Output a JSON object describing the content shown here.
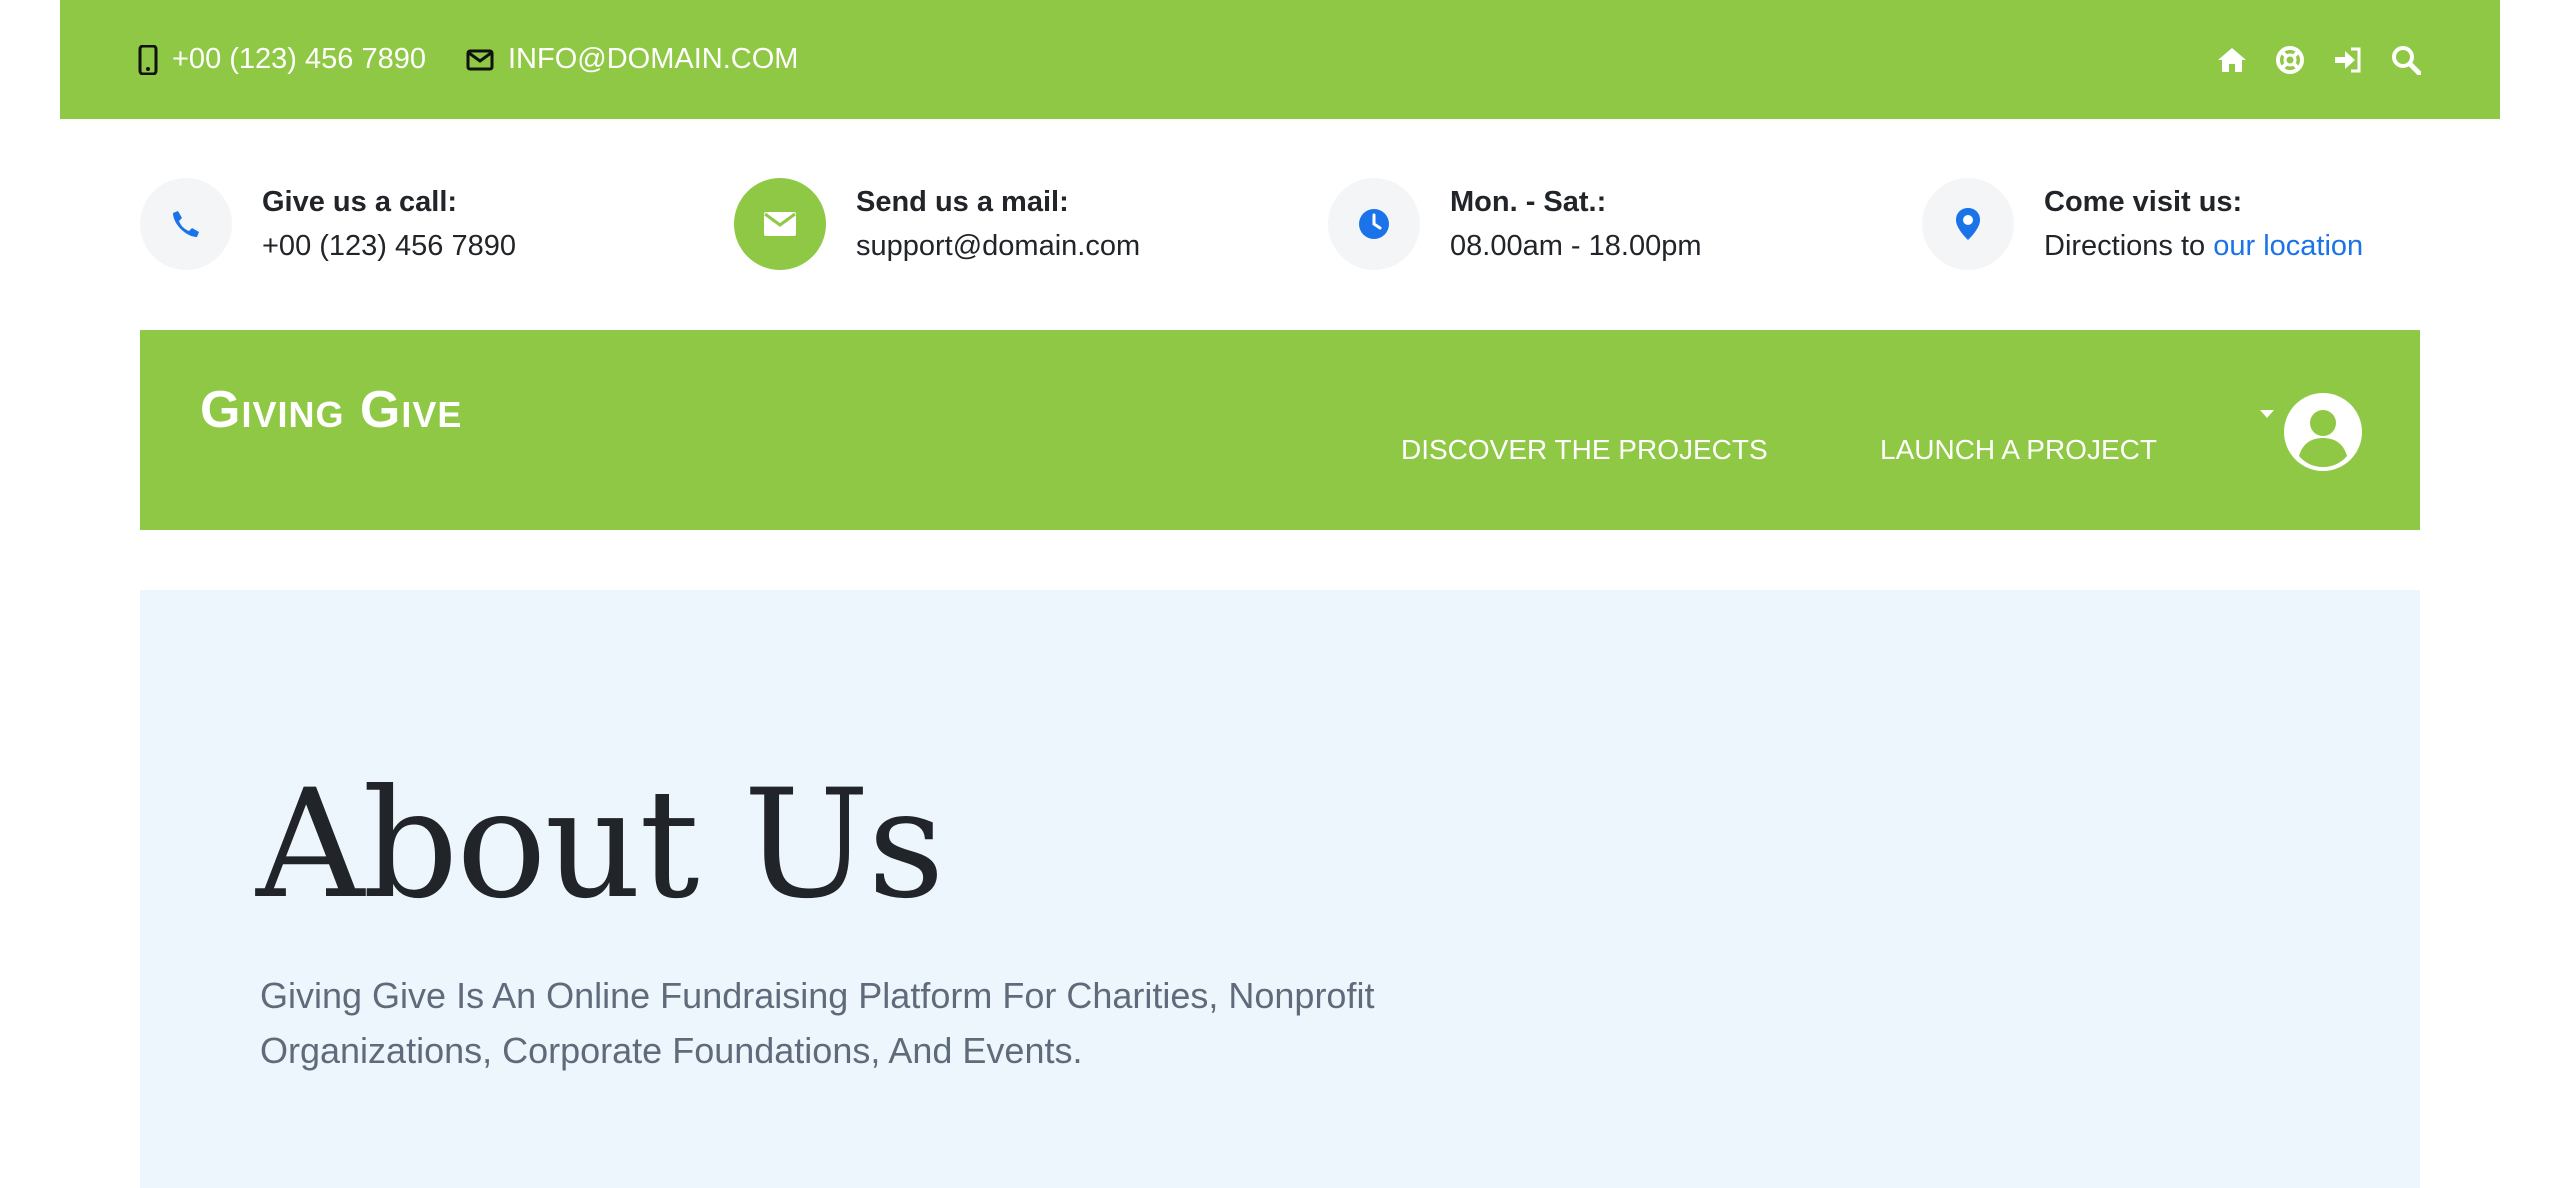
{
  "topbar": {
    "phone": "+00 (123) 456 7890",
    "email": "INFO@DOMAIN.COM",
    "icons": [
      "home-icon",
      "life-ring-icon",
      "sign-in-icon",
      "search-icon"
    ]
  },
  "info": [
    {
      "label": "Give us a call:",
      "value": "+00 (123) 456 7890",
      "icon": "phone-icon"
    },
    {
      "label": "Send us a mail:",
      "value": "support@domain.com",
      "icon": "envelope-icon"
    },
    {
      "label": "Mon. - Sat.:",
      "value": "08.00am - 18.00pm",
      "icon": "clock-icon"
    },
    {
      "label": "Come visit us:",
      "value_prefix": "Directions to",
      "link": "our location",
      "icon": "map-pin-icon"
    }
  ],
  "nav": {
    "brand": "Giving Give",
    "links": [
      "DISCOVER THE PROJECTS",
      "LAUNCH A PROJECT"
    ]
  },
  "hero": {
    "title": "About Us",
    "subtitle": "Giving Give Is An Online Fundraising Platform For Charities, Nonprofit Organizations, Corporate Foundations, And Events."
  },
  "colors": {
    "brand_green": "#8fc844",
    "accent_blue": "#1a73e8",
    "hero_bg": "#eef6fd"
  }
}
